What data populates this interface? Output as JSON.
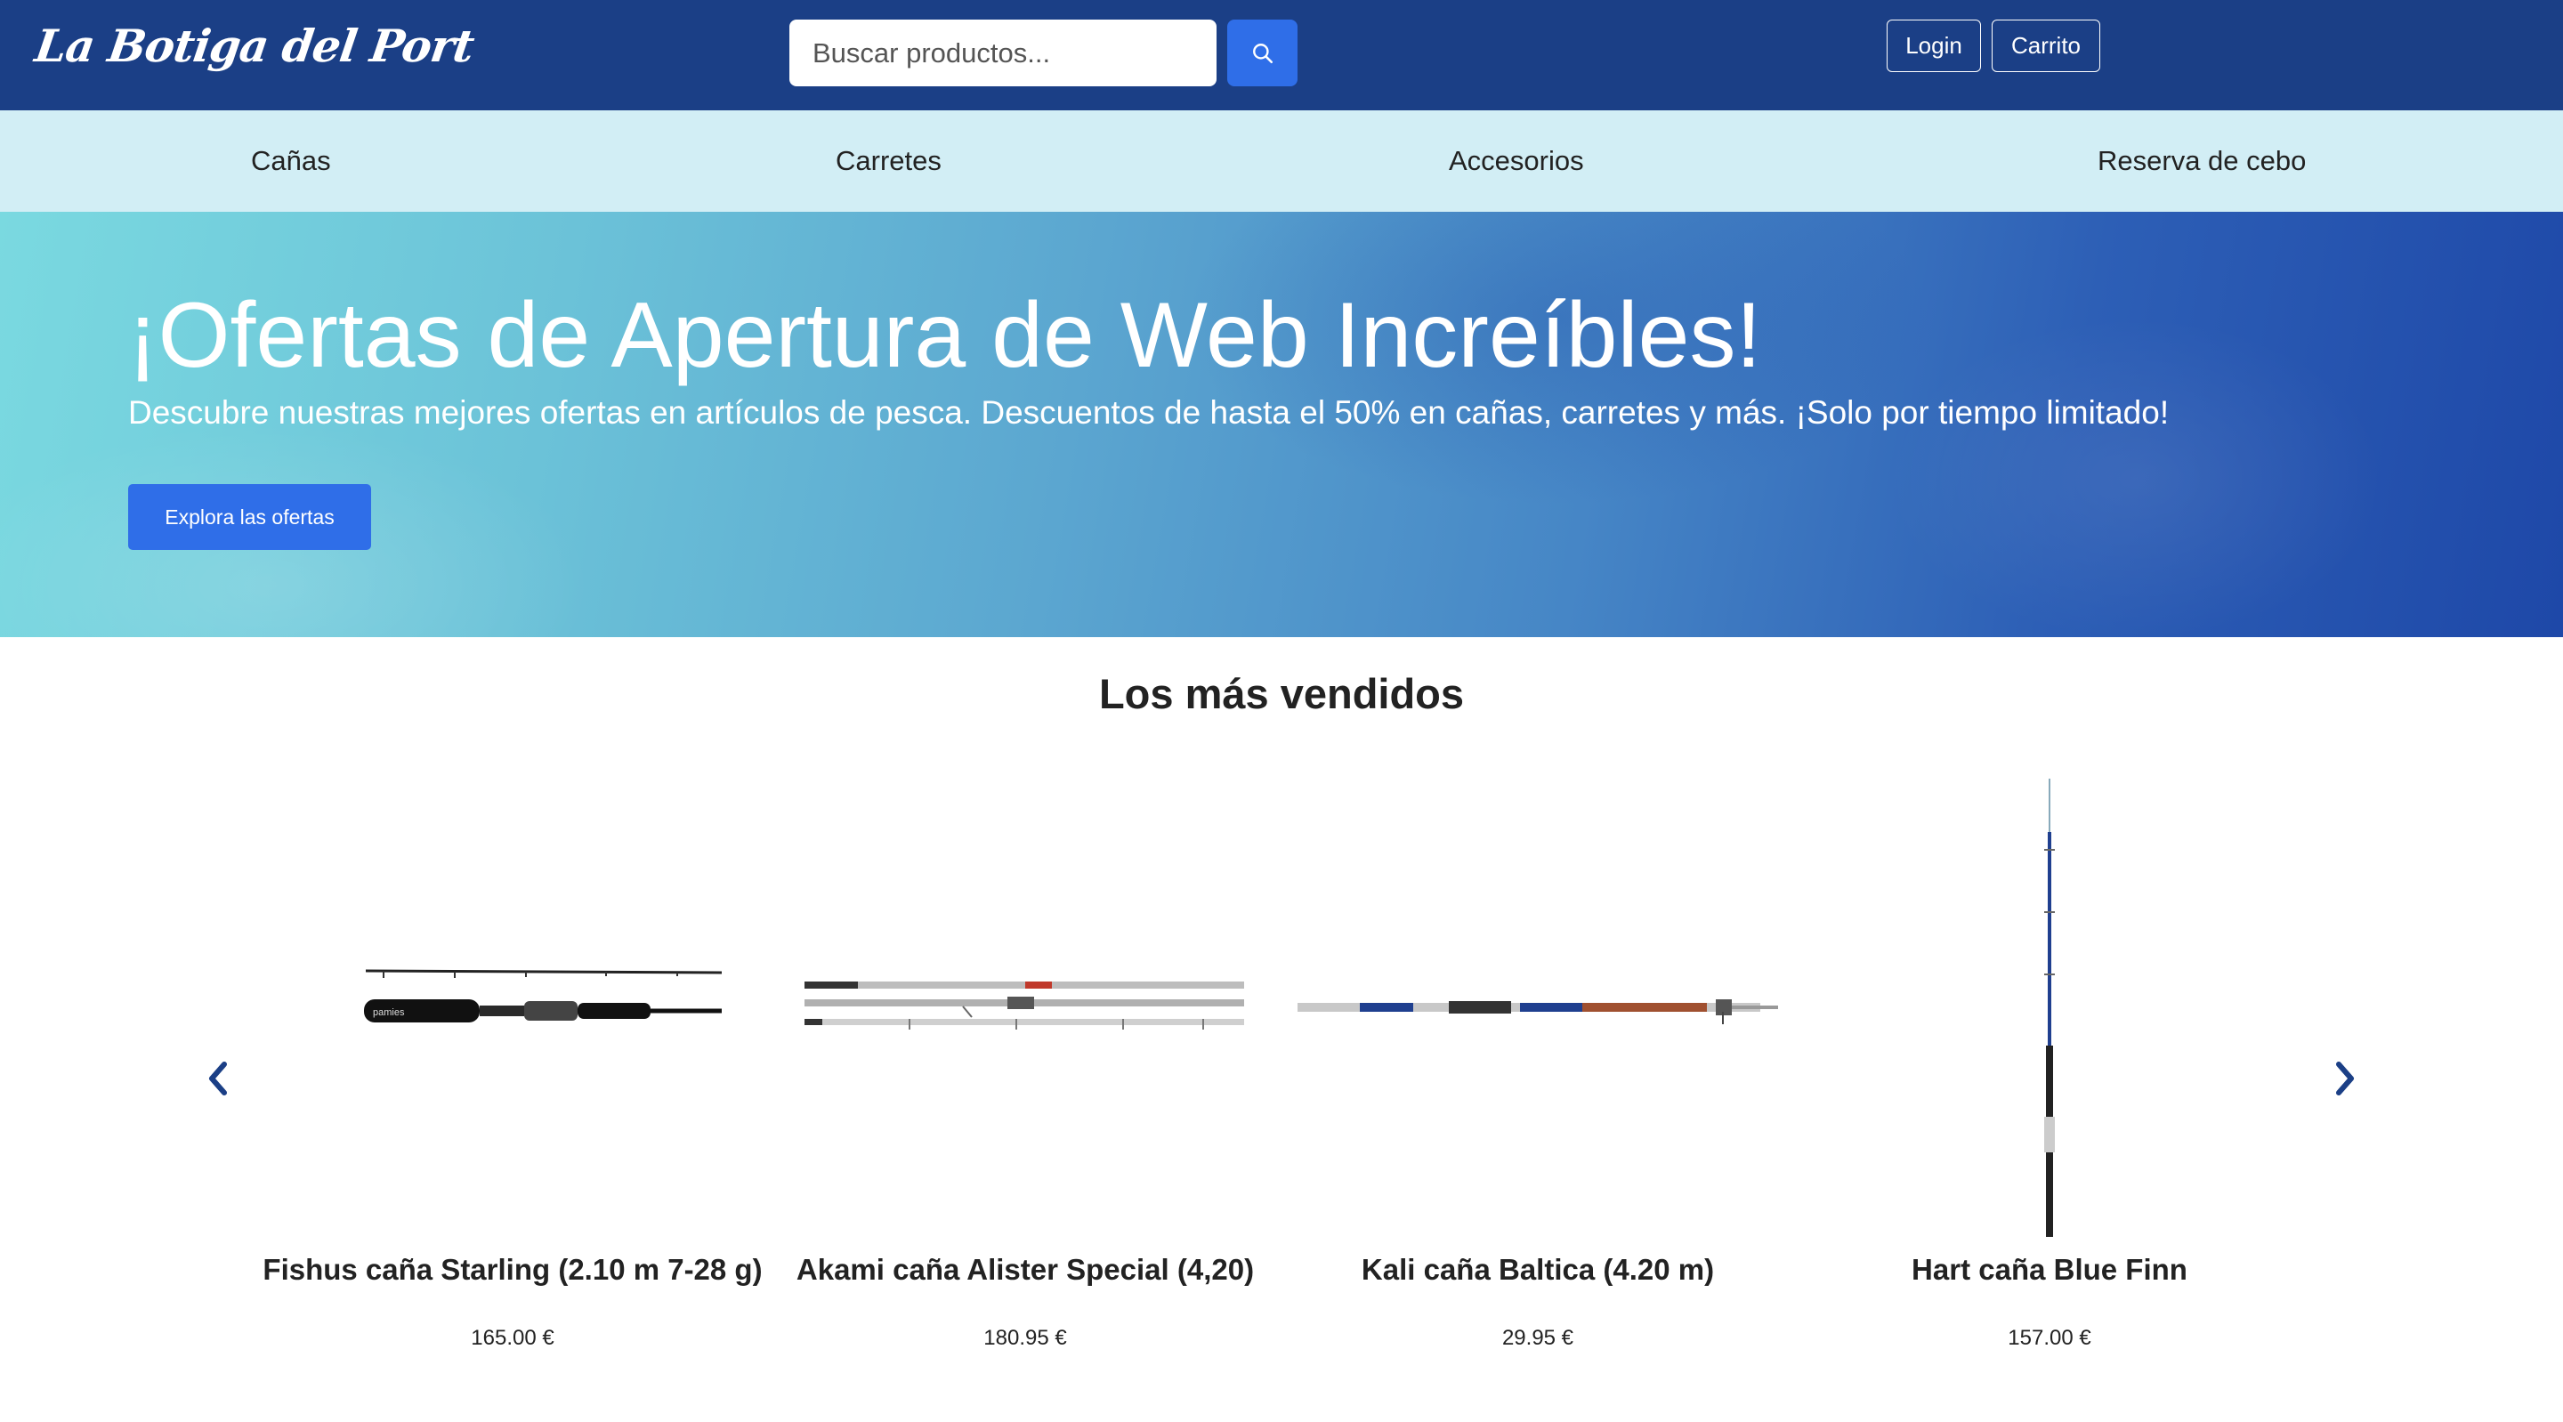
{
  "header": {
    "logo_text": "La Botiga del Port",
    "search_placeholder": "Buscar productos...",
    "search_icon": "search-icon",
    "login_label": "Login",
    "cart_label": "Carrito",
    "bg_color": "#1b3f86",
    "accent_color": "#2f6ee8"
  },
  "nav": {
    "items": [
      {
        "label": "Cañas"
      },
      {
        "label": "Carretes"
      },
      {
        "label": "Accesorios"
      },
      {
        "label": "Reserva de cebo"
      }
    ],
    "bg_color": "#d2eef5"
  },
  "hero": {
    "title": "¡Ofertas de Apertura de Web Increíbles!",
    "subtitle": "Descubre nuestras mejores ofertas en artículos de pesca. Descuentos de hasta el 50% en cañas, carretes y más. ¡Solo por tiempo limitado!",
    "button_label": "Explora las ofertas"
  },
  "bestsellers": {
    "title": "Los más vendidos",
    "prev_icon": "chevron-left-icon",
    "next_icon": "chevron-right-icon",
    "products": [
      {
        "name": "Fishus caña Starling (2.10 m 7-28 g)",
        "price": "165.00 €",
        "image_icon": "fishing-rod-black-icon"
      },
      {
        "name": "Akami caña Alister Special (4,20)",
        "price": "180.95 €",
        "image_icon": "fishing-rod-sections-icon"
      },
      {
        "name": "Kali caña Baltica (4.20 m)",
        "price": "29.95 €",
        "image_icon": "fishing-rod-telescopic-icon"
      },
      {
        "name": "Hart caña Blue Finn",
        "price": "157.00 €",
        "image_icon": "fishing-rod-vertical-icon"
      }
    ]
  }
}
